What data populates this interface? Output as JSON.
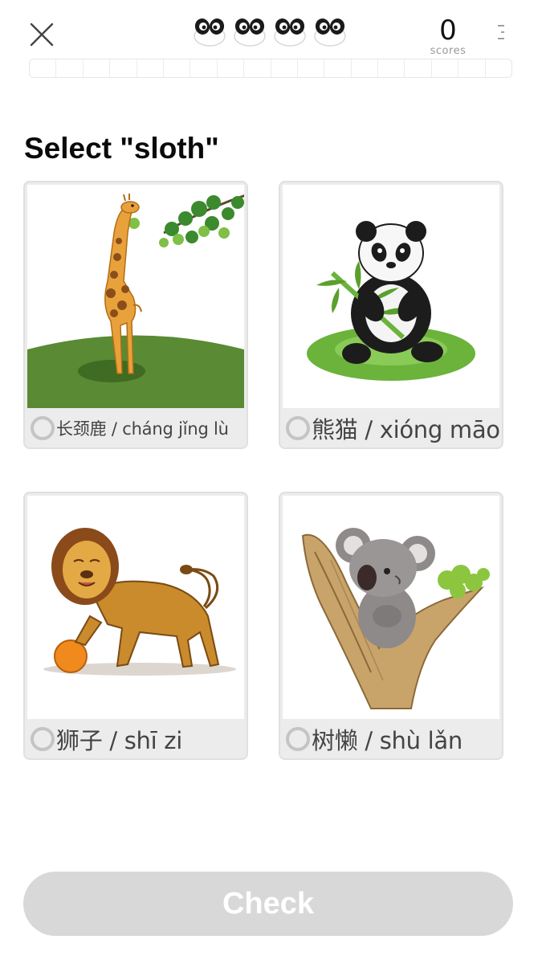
{
  "header": {
    "close_icon": "close-icon",
    "lives": {
      "count": 4,
      "icon": "panda-eyes-icon"
    },
    "score": {
      "value": "0",
      "label": "scores"
    },
    "menu_icon": "vertical-dots-icon",
    "progress": {
      "segments": 18,
      "completed_fraction": 0.0
    }
  },
  "question": {
    "text": "Select \"sloth\""
  },
  "options": [
    {
      "id": "giraffe",
      "label": "长颈鹿 / cháng jǐng lù",
      "label_size": "small",
      "image": "giraffe-illustration",
      "selected": false
    },
    {
      "id": "panda",
      "label": "熊猫 / xióng māo",
      "label_size": "large",
      "image": "panda-illustration",
      "selected": false
    },
    {
      "id": "lion",
      "label": "狮子 / shī zi",
      "label_size": "large",
      "image": "lion-illustration",
      "selected": false
    },
    {
      "id": "sloth",
      "label": "树懒 / shù lǎn",
      "label_size": "large",
      "image": "koala-in-tree-illustration",
      "selected": false
    }
  ],
  "footer": {
    "check_label": "Check",
    "check_enabled": false
  },
  "colors": {
    "check_disabled_bg": "#d8d8d8",
    "check_text": "#ffffff",
    "card_bg": "#ececec",
    "radio_border": "#c4c4c4",
    "label_text": "#444444",
    "score_label": "#9a9a9a"
  }
}
